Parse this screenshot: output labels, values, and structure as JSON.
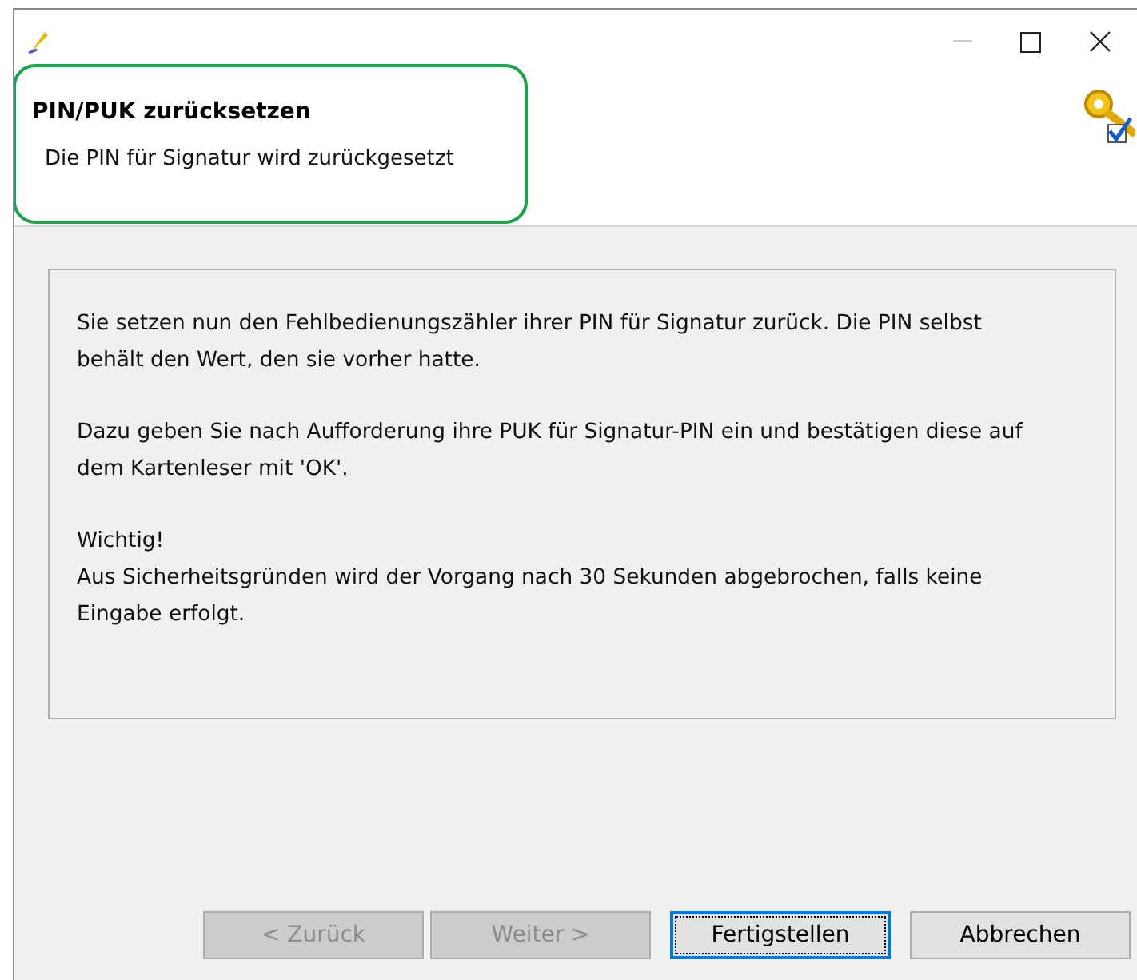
{
  "header": {
    "title": "PIN/PUK zurücksetzen",
    "subtitle": "Die PIN für Signatur wird zurückgesetzt",
    "highlighted": true
  },
  "paragraphs": [
    "Sie setzen nun den Fehlbedienungszähler ihrer PIN für Signatur zurück. Die PIN selbst behält den Wert, den sie vorher hatte.",
    "Dazu geben Sie nach Aufforderung ihre PUK für Signatur-PIN ein und bestätigen diese auf dem Kartenleser mit 'OK'.",
    "Wichtig!\nAus Sicherheitsgründen wird der Vorgang nach 30 Sekunden abgebrochen, falls keine Eingabe erfolgt."
  ],
  "buttons": [
    {
      "label": "< Zurück",
      "disabled": true,
      "focused": false
    },
    {
      "label": "Weiter >",
      "disabled": true,
      "focused": false
    },
    {
      "label": "Fertigstellen",
      "disabled": false,
      "focused": true
    },
    {
      "label": "Abbrechen",
      "disabled": false,
      "focused": false
    }
  ]
}
